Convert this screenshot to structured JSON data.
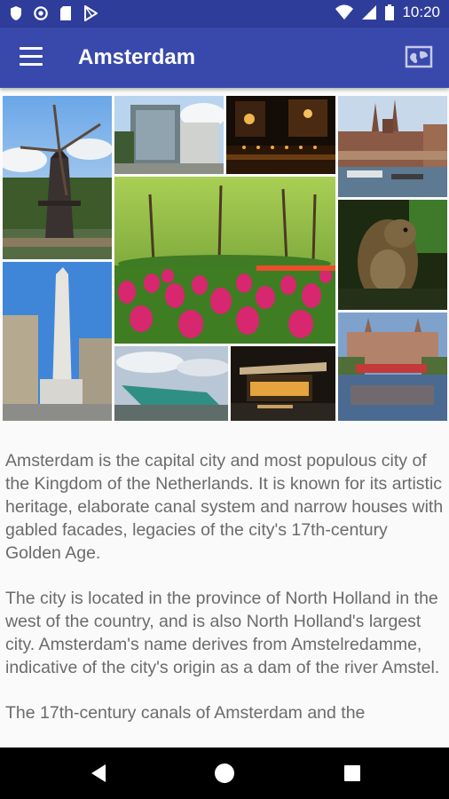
{
  "status_bar": {
    "time": "10:20",
    "left_icons": [
      "shield-icon",
      "circle-icon",
      "sd-card-icon",
      "play-store-icon"
    ],
    "right_icons": [
      "wifi-icon",
      "signal-icon",
      "battery-icon"
    ]
  },
  "app_bar": {
    "title": "Amsterdam",
    "menu_icon": "menu-icon",
    "map_icon": "map-icon",
    "color": "#3949ab"
  },
  "collage": {
    "photos": [
      "Windmill",
      "Modern building",
      "Canal at night",
      "Central Station",
      "Tulip field",
      "Otter",
      "Monument",
      "Museum at dusk",
      "NEMO ship building",
      "Rijksmuseum"
    ]
  },
  "content": {
    "paragraphs": [
      "Amsterdam is the capital city and most populous city of the Kingdom of the Netherlands. It is known for its artistic heritage, elaborate canal system and narrow houses with gabled facades, legacies of the city's 17th-century Golden Age.",
      "The city is located in the province of North Holland in the west of the country, and is also North Holland's largest city. Amsterdam's name derives from Amstelredamme, indicative of the city's origin as a dam of the river Amstel.",
      "The 17th-century canals of Amsterdam and the"
    ]
  },
  "nav_bar": {
    "buttons": [
      "back-icon",
      "home-icon",
      "recents-icon"
    ]
  }
}
